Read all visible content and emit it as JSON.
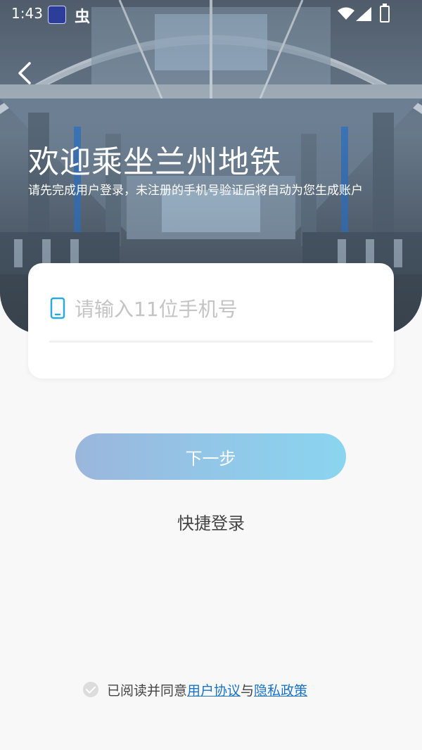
{
  "status_bar": {
    "time": "1:43",
    "app_icon_2": "虫"
  },
  "header": {
    "title": "欢迎乘坐兰州地铁",
    "subtitle": "请先完成用户登录，未注册的手机号验证后将自动为您生成账户"
  },
  "form": {
    "phone_placeholder": "请输入11位手机号",
    "phone_value": ""
  },
  "actions": {
    "next_label": "下一步",
    "quick_login_label": "快捷登录"
  },
  "agreement": {
    "prefix": "已阅读并同意",
    "user_agreement": "用户协议",
    "joiner": "与",
    "privacy_policy": "隐私政策"
  },
  "colors": {
    "accent_link": "#1a73c8",
    "icon_blue": "#29a9e0",
    "button_gradient_start": "#9bb6dc",
    "button_gradient_end": "#8ad5ef"
  },
  "icons": {
    "back": "chevron-left-icon",
    "phone": "mobile-phone-icon",
    "check": "check-circle-icon"
  }
}
